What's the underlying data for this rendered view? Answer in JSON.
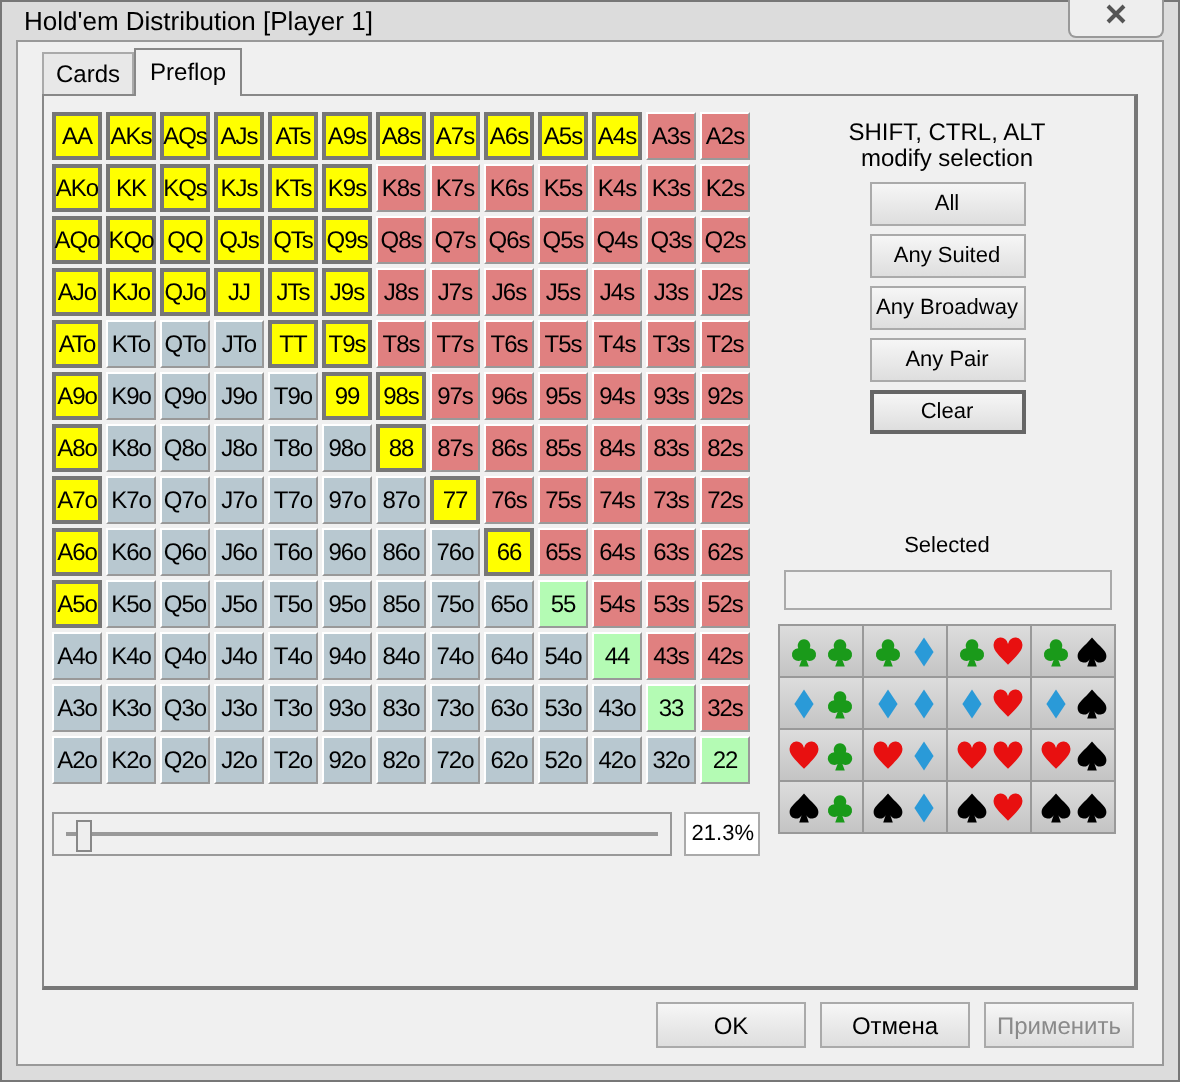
{
  "window": {
    "title": "Hold'em Distribution [Player 1]"
  },
  "tabs": [
    {
      "label": "Cards",
      "selected": false
    },
    {
      "label": "Preflop",
      "selected": true
    }
  ],
  "grid": [
    [
      {
        "label": "AA",
        "kind": "pair",
        "selected": true
      },
      {
        "label": "AKs",
        "kind": "suited",
        "selected": true
      },
      {
        "label": "AQs",
        "kind": "suited",
        "selected": true
      },
      {
        "label": "AJs",
        "kind": "suited",
        "selected": true
      },
      {
        "label": "ATs",
        "kind": "suited",
        "selected": true
      },
      {
        "label": "A9s",
        "kind": "suited",
        "selected": true
      },
      {
        "label": "A8s",
        "kind": "suited",
        "selected": true
      },
      {
        "label": "A7s",
        "kind": "suited",
        "selected": true
      },
      {
        "label": "A6s",
        "kind": "suited",
        "selected": true
      },
      {
        "label": "A5s",
        "kind": "suited",
        "selected": true
      },
      {
        "label": "A4s",
        "kind": "suited",
        "selected": true
      },
      {
        "label": "A3s",
        "kind": "suited",
        "selected": false
      },
      {
        "label": "A2s",
        "kind": "suited",
        "selected": false
      }
    ],
    [
      {
        "label": "AKo",
        "kind": "offsuit",
        "selected": true
      },
      {
        "label": "KK",
        "kind": "pair",
        "selected": true
      },
      {
        "label": "KQs",
        "kind": "suited",
        "selected": true
      },
      {
        "label": "KJs",
        "kind": "suited",
        "selected": true
      },
      {
        "label": "KTs",
        "kind": "suited",
        "selected": true
      },
      {
        "label": "K9s",
        "kind": "suited",
        "selected": true
      },
      {
        "label": "K8s",
        "kind": "suited",
        "selected": false
      },
      {
        "label": "K7s",
        "kind": "suited",
        "selected": false
      },
      {
        "label": "K6s",
        "kind": "suited",
        "selected": false
      },
      {
        "label": "K5s",
        "kind": "suited",
        "selected": false
      },
      {
        "label": "K4s",
        "kind": "suited",
        "selected": false
      },
      {
        "label": "K3s",
        "kind": "suited",
        "selected": false
      },
      {
        "label": "K2s",
        "kind": "suited",
        "selected": false
      }
    ],
    [
      {
        "label": "AQo",
        "kind": "offsuit",
        "selected": true
      },
      {
        "label": "KQo",
        "kind": "offsuit",
        "selected": true
      },
      {
        "label": "QQ",
        "kind": "pair",
        "selected": true
      },
      {
        "label": "QJs",
        "kind": "suited",
        "selected": true
      },
      {
        "label": "QTs",
        "kind": "suited",
        "selected": true
      },
      {
        "label": "Q9s",
        "kind": "suited",
        "selected": true
      },
      {
        "label": "Q8s",
        "kind": "suited",
        "selected": false
      },
      {
        "label": "Q7s",
        "kind": "suited",
        "selected": false
      },
      {
        "label": "Q6s",
        "kind": "suited",
        "selected": false
      },
      {
        "label": "Q5s",
        "kind": "suited",
        "selected": false
      },
      {
        "label": "Q4s",
        "kind": "suited",
        "selected": false
      },
      {
        "label": "Q3s",
        "kind": "suited",
        "selected": false
      },
      {
        "label": "Q2s",
        "kind": "suited",
        "selected": false
      }
    ],
    [
      {
        "label": "AJo",
        "kind": "offsuit",
        "selected": true
      },
      {
        "label": "KJo",
        "kind": "offsuit",
        "selected": true
      },
      {
        "label": "QJo",
        "kind": "offsuit",
        "selected": true
      },
      {
        "label": "JJ",
        "kind": "pair",
        "selected": true
      },
      {
        "label": "JTs",
        "kind": "suited",
        "selected": true
      },
      {
        "label": "J9s",
        "kind": "suited",
        "selected": true
      },
      {
        "label": "J8s",
        "kind": "suited",
        "selected": false
      },
      {
        "label": "J7s",
        "kind": "suited",
        "selected": false
      },
      {
        "label": "J6s",
        "kind": "suited",
        "selected": false
      },
      {
        "label": "J5s",
        "kind": "suited",
        "selected": false
      },
      {
        "label": "J4s",
        "kind": "suited",
        "selected": false
      },
      {
        "label": "J3s",
        "kind": "suited",
        "selected": false
      },
      {
        "label": "J2s",
        "kind": "suited",
        "selected": false
      }
    ],
    [
      {
        "label": "ATo",
        "kind": "offsuit",
        "selected": true
      },
      {
        "label": "KTo",
        "kind": "offsuit",
        "selected": false
      },
      {
        "label": "QTo",
        "kind": "offsuit",
        "selected": false
      },
      {
        "label": "JTo",
        "kind": "offsuit",
        "selected": false
      },
      {
        "label": "TT",
        "kind": "pair",
        "selected": true
      },
      {
        "label": "T9s",
        "kind": "suited",
        "selected": true
      },
      {
        "label": "T8s",
        "kind": "suited",
        "selected": false
      },
      {
        "label": "T7s",
        "kind": "suited",
        "selected": false
      },
      {
        "label": "T6s",
        "kind": "suited",
        "selected": false
      },
      {
        "label": "T5s",
        "kind": "suited",
        "selected": false
      },
      {
        "label": "T4s",
        "kind": "suited",
        "selected": false
      },
      {
        "label": "T3s",
        "kind": "suited",
        "selected": false
      },
      {
        "label": "T2s",
        "kind": "suited",
        "selected": false
      }
    ],
    [
      {
        "label": "A9o",
        "kind": "offsuit",
        "selected": true
      },
      {
        "label": "K9o",
        "kind": "offsuit",
        "selected": false
      },
      {
        "label": "Q9o",
        "kind": "offsuit",
        "selected": false
      },
      {
        "label": "J9o",
        "kind": "offsuit",
        "selected": false
      },
      {
        "label": "T9o",
        "kind": "offsuit",
        "selected": false
      },
      {
        "label": "99",
        "kind": "pair",
        "selected": true
      },
      {
        "label": "98s",
        "kind": "suited",
        "selected": true
      },
      {
        "label": "97s",
        "kind": "suited",
        "selected": false
      },
      {
        "label": "96s",
        "kind": "suited",
        "selected": false
      },
      {
        "label": "95s",
        "kind": "suited",
        "selected": false
      },
      {
        "label": "94s",
        "kind": "suited",
        "selected": false
      },
      {
        "label": "93s",
        "kind": "suited",
        "selected": false
      },
      {
        "label": "92s",
        "kind": "suited",
        "selected": false
      }
    ],
    [
      {
        "label": "A8o",
        "kind": "offsuit",
        "selected": true
      },
      {
        "label": "K8o",
        "kind": "offsuit",
        "selected": false
      },
      {
        "label": "Q8o",
        "kind": "offsuit",
        "selected": false
      },
      {
        "label": "J8o",
        "kind": "offsuit",
        "selected": false
      },
      {
        "label": "T8o",
        "kind": "offsuit",
        "selected": false
      },
      {
        "label": "98o",
        "kind": "offsuit",
        "selected": false
      },
      {
        "label": "88",
        "kind": "pair",
        "selected": true
      },
      {
        "label": "87s",
        "kind": "suited",
        "selected": false
      },
      {
        "label": "86s",
        "kind": "suited",
        "selected": false
      },
      {
        "label": "85s",
        "kind": "suited",
        "selected": false
      },
      {
        "label": "84s",
        "kind": "suited",
        "selected": false
      },
      {
        "label": "83s",
        "kind": "suited",
        "selected": false
      },
      {
        "label": "82s",
        "kind": "suited",
        "selected": false
      }
    ],
    [
      {
        "label": "A7o",
        "kind": "offsuit",
        "selected": true
      },
      {
        "label": "K7o",
        "kind": "offsuit",
        "selected": false
      },
      {
        "label": "Q7o",
        "kind": "offsuit",
        "selected": false
      },
      {
        "label": "J7o",
        "kind": "offsuit",
        "selected": false
      },
      {
        "label": "T7o",
        "kind": "offsuit",
        "selected": false
      },
      {
        "label": "97o",
        "kind": "offsuit",
        "selected": false
      },
      {
        "label": "87o",
        "kind": "offsuit",
        "selected": false
      },
      {
        "label": "77",
        "kind": "pair",
        "selected": true
      },
      {
        "label": "76s",
        "kind": "suited",
        "selected": false
      },
      {
        "label": "75s",
        "kind": "suited",
        "selected": false
      },
      {
        "label": "74s",
        "kind": "suited",
        "selected": false
      },
      {
        "label": "73s",
        "kind": "suited",
        "selected": false
      },
      {
        "label": "72s",
        "kind": "suited",
        "selected": false
      }
    ],
    [
      {
        "label": "A6o",
        "kind": "offsuit",
        "selected": true
      },
      {
        "label": "K6o",
        "kind": "offsuit",
        "selected": false
      },
      {
        "label": "Q6o",
        "kind": "offsuit",
        "selected": false
      },
      {
        "label": "J6o",
        "kind": "offsuit",
        "selected": false
      },
      {
        "label": "T6o",
        "kind": "offsuit",
        "selected": false
      },
      {
        "label": "96o",
        "kind": "offsuit",
        "selected": false
      },
      {
        "label": "86o",
        "kind": "offsuit",
        "selected": false
      },
      {
        "label": "76o",
        "kind": "offsuit",
        "selected": false
      },
      {
        "label": "66",
        "kind": "pair",
        "selected": true
      },
      {
        "label": "65s",
        "kind": "suited",
        "selected": false
      },
      {
        "label": "64s",
        "kind": "suited",
        "selected": false
      },
      {
        "label": "63s",
        "kind": "suited",
        "selected": false
      },
      {
        "label": "62s",
        "kind": "suited",
        "selected": false
      }
    ],
    [
      {
        "label": "A5o",
        "kind": "offsuit",
        "selected": true
      },
      {
        "label": "K5o",
        "kind": "offsuit",
        "selected": false
      },
      {
        "label": "Q5o",
        "kind": "offsuit",
        "selected": false
      },
      {
        "label": "J5o",
        "kind": "offsuit",
        "selected": false
      },
      {
        "label": "T5o",
        "kind": "offsuit",
        "selected": false
      },
      {
        "label": "95o",
        "kind": "offsuit",
        "selected": false
      },
      {
        "label": "85o",
        "kind": "offsuit",
        "selected": false
      },
      {
        "label": "75o",
        "kind": "offsuit",
        "selected": false
      },
      {
        "label": "65o",
        "kind": "offsuit",
        "selected": false
      },
      {
        "label": "55",
        "kind": "pair",
        "selected": false
      },
      {
        "label": "54s",
        "kind": "suited",
        "selected": false
      },
      {
        "label": "53s",
        "kind": "suited",
        "selected": false
      },
      {
        "label": "52s",
        "kind": "suited",
        "selected": false
      }
    ],
    [
      {
        "label": "A4o",
        "kind": "offsuit",
        "selected": false
      },
      {
        "label": "K4o",
        "kind": "offsuit",
        "selected": false
      },
      {
        "label": "Q4o",
        "kind": "offsuit",
        "selected": false
      },
      {
        "label": "J4o",
        "kind": "offsuit",
        "selected": false
      },
      {
        "label": "T4o",
        "kind": "offsuit",
        "selected": false
      },
      {
        "label": "94o",
        "kind": "offsuit",
        "selected": false
      },
      {
        "label": "84o",
        "kind": "offsuit",
        "selected": false
      },
      {
        "label": "74o",
        "kind": "offsuit",
        "selected": false
      },
      {
        "label": "64o",
        "kind": "offsuit",
        "selected": false
      },
      {
        "label": "54o",
        "kind": "offsuit",
        "selected": false
      },
      {
        "label": "44",
        "kind": "pair",
        "selected": false
      },
      {
        "label": "43s",
        "kind": "suited",
        "selected": false
      },
      {
        "label": "42s",
        "kind": "suited",
        "selected": false
      }
    ],
    [
      {
        "label": "A3o",
        "kind": "offsuit",
        "selected": false
      },
      {
        "label": "K3o",
        "kind": "offsuit",
        "selected": false
      },
      {
        "label": "Q3o",
        "kind": "offsuit",
        "selected": false
      },
      {
        "label": "J3o",
        "kind": "offsuit",
        "selected": false
      },
      {
        "label": "T3o",
        "kind": "offsuit",
        "selected": false
      },
      {
        "label": "93o",
        "kind": "offsuit",
        "selected": false
      },
      {
        "label": "83o",
        "kind": "offsuit",
        "selected": false
      },
      {
        "label": "73o",
        "kind": "offsuit",
        "selected": false
      },
      {
        "label": "63o",
        "kind": "offsuit",
        "selected": false
      },
      {
        "label": "53o",
        "kind": "offsuit",
        "selected": false
      },
      {
        "label": "43o",
        "kind": "offsuit",
        "selected": false
      },
      {
        "label": "33",
        "kind": "pair",
        "selected": false
      },
      {
        "label": "32s",
        "kind": "suited",
        "selected": false
      }
    ],
    [
      {
        "label": "A2o",
        "kind": "offsuit",
        "selected": false
      },
      {
        "label": "K2o",
        "kind": "offsuit",
        "selected": false
      },
      {
        "label": "Q2o",
        "kind": "offsuit",
        "selected": false
      },
      {
        "label": "J2o",
        "kind": "offsuit",
        "selected": false
      },
      {
        "label": "T2o",
        "kind": "offsuit",
        "selected": false
      },
      {
        "label": "92o",
        "kind": "offsuit",
        "selected": false
      },
      {
        "label": "82o",
        "kind": "offsuit",
        "selected": false
      },
      {
        "label": "72o",
        "kind": "offsuit",
        "selected": false
      },
      {
        "label": "62o",
        "kind": "offsuit",
        "selected": false
      },
      {
        "label": "52o",
        "kind": "offsuit",
        "selected": false
      },
      {
        "label": "42o",
        "kind": "offsuit",
        "selected": false
      },
      {
        "label": "32o",
        "kind": "offsuit",
        "selected": false
      },
      {
        "label": "22",
        "kind": "pair",
        "selected": false
      }
    ]
  ],
  "slider": {
    "level": 0.02,
    "reading": "21.3%"
  },
  "hint": {
    "line_1": "SHIFT, CTRL, ALT",
    "line_2": "modify selection"
  },
  "select_buttons": [
    {
      "label": "All",
      "default": false
    },
    {
      "label": "Any Suited",
      "default": false
    },
    {
      "label": "Any Broadway",
      "default": false
    },
    {
      "label": "Any Pair",
      "default": false
    },
    {
      "label": "Clear",
      "default": true
    }
  ],
  "selected_label": "Selected",
  "suit_combos": [
    {
      "cards": [
        {
          "kind": "clubs"
        },
        {
          "kind": "clubs"
        }
      ]
    },
    {
      "cards": [
        {
          "kind": "clubs"
        },
        {
          "kind": "diamonds"
        }
      ]
    },
    {
      "cards": [
        {
          "kind": "clubs"
        },
        {
          "kind": "hearts"
        }
      ]
    },
    {
      "cards": [
        {
          "kind": "clubs"
        },
        {
          "kind": "spades"
        }
      ]
    },
    {
      "cards": [
        {
          "kind": "diamonds"
        },
        {
          "kind": "clubs"
        }
      ]
    },
    {
      "cards": [
        {
          "kind": "diamonds"
        },
        {
          "kind": "diamonds"
        }
      ]
    },
    {
      "cards": [
        {
          "kind": "diamonds"
        },
        {
          "kind": "hearts"
        }
      ]
    },
    {
      "cards": [
        {
          "kind": "diamonds"
        },
        {
          "kind": "spades"
        }
      ]
    },
    {
      "cards": [
        {
          "kind": "hearts"
        },
        {
          "kind": "clubs"
        }
      ]
    },
    {
      "cards": [
        {
          "kind": "hearts"
        },
        {
          "kind": "diamonds"
        }
      ]
    },
    {
      "cards": [
        {
          "kind": "hearts"
        },
        {
          "kind": "hearts"
        }
      ]
    },
    {
      "cards": [
        {
          "kind": "hearts"
        },
        {
          "kind": "spades"
        }
      ]
    },
    {
      "cards": [
        {
          "kind": "spades"
        },
        {
          "kind": "clubs"
        }
      ]
    },
    {
      "cards": [
        {
          "kind": "spades"
        },
        {
          "kind": "diamonds"
        }
      ]
    },
    {
      "cards": [
        {
          "kind": "spades"
        },
        {
          "kind": "hearts"
        }
      ]
    },
    {
      "cards": [
        {
          "kind": "spades"
        },
        {
          "kind": "spades"
        }
      ]
    }
  ],
  "footer_buttons": [
    {
      "label": "OK",
      "disabled": false
    },
    {
      "label": "Отмена",
      "disabled": false
    },
    {
      "label": "Применить",
      "disabled": true
    }
  ]
}
